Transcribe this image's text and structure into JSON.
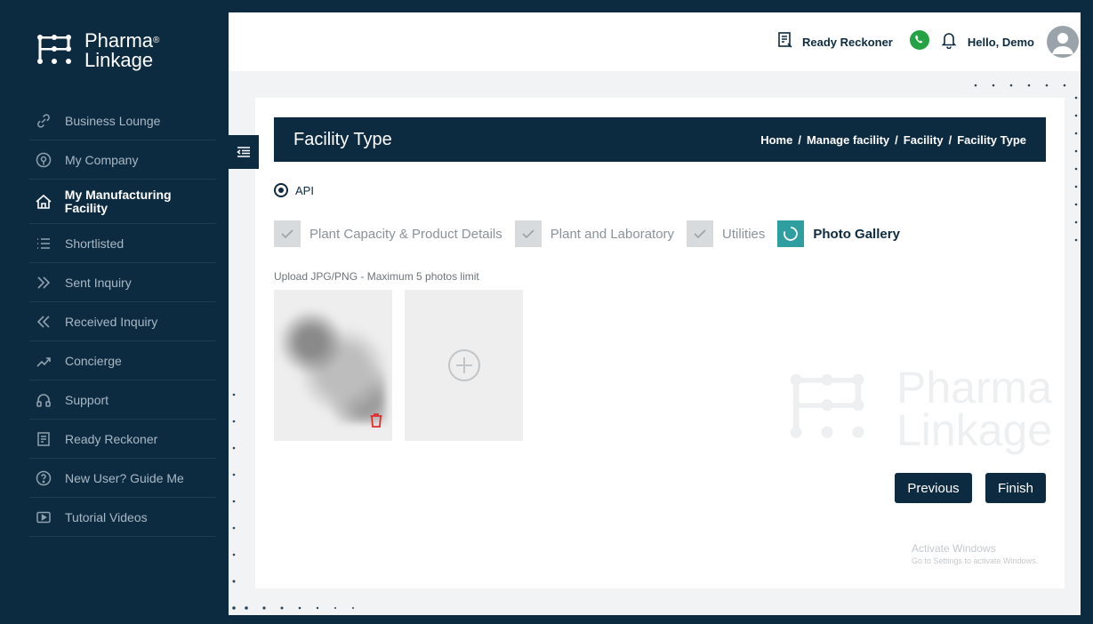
{
  "brand": {
    "line1": "Pharma",
    "line2": "Linkage",
    "reg": "®"
  },
  "sidebar": {
    "items": [
      {
        "label": "Business Lounge",
        "icon": "link-icon"
      },
      {
        "label": "My Company",
        "icon": "location-pin-icon"
      },
      {
        "label": "My Manufacturing Facility",
        "icon": "home-icon",
        "active": true
      },
      {
        "label": "Shortlisted",
        "icon": "list-icon"
      },
      {
        "label": "Sent Inquiry",
        "icon": "double-chevron-right-icon"
      },
      {
        "label": "Received Inquiry",
        "icon": "double-chevron-left-icon"
      },
      {
        "label": "Concierge",
        "icon": "trend-line-icon"
      },
      {
        "label": "Support",
        "icon": "headset-icon"
      },
      {
        "label": "Ready Reckoner",
        "icon": "document-icon"
      },
      {
        "label": "New User? Guide Me",
        "icon": "question-circle-icon"
      },
      {
        "label": "Tutorial Videos",
        "icon": "video-icon"
      }
    ]
  },
  "topbar": {
    "ready_reckoner": "Ready Reckoner",
    "greeting": "Hello, Demo"
  },
  "page": {
    "title": "Facility Type",
    "breadcrumb": [
      "Home",
      "Manage facility",
      "Facility",
      "Facility Type"
    ],
    "radio_label": "API",
    "steps": [
      {
        "label": "Plant Capacity & Product Details",
        "state": "done"
      },
      {
        "label": "Plant and Laboratory",
        "state": "done"
      },
      {
        "label": "Utilities",
        "state": "done"
      },
      {
        "label": "Photo Gallery",
        "state": "current"
      }
    ],
    "upload_note": "Upload JPG/PNG - Maximum 5 photos limit",
    "buttons": {
      "previous": "Previous",
      "finish": "Finish"
    },
    "watermark": {
      "line1": "Pharma",
      "line2": "Linkage"
    }
  },
  "os_notice": {
    "title": "Activate Windows",
    "subtitle": "Go to Settings to activate Windows."
  },
  "colors": {
    "navy": "#0d2b40",
    "teal": "#2e9ea1",
    "whatsapp": "#25a244",
    "delete": "#e02b2b"
  }
}
